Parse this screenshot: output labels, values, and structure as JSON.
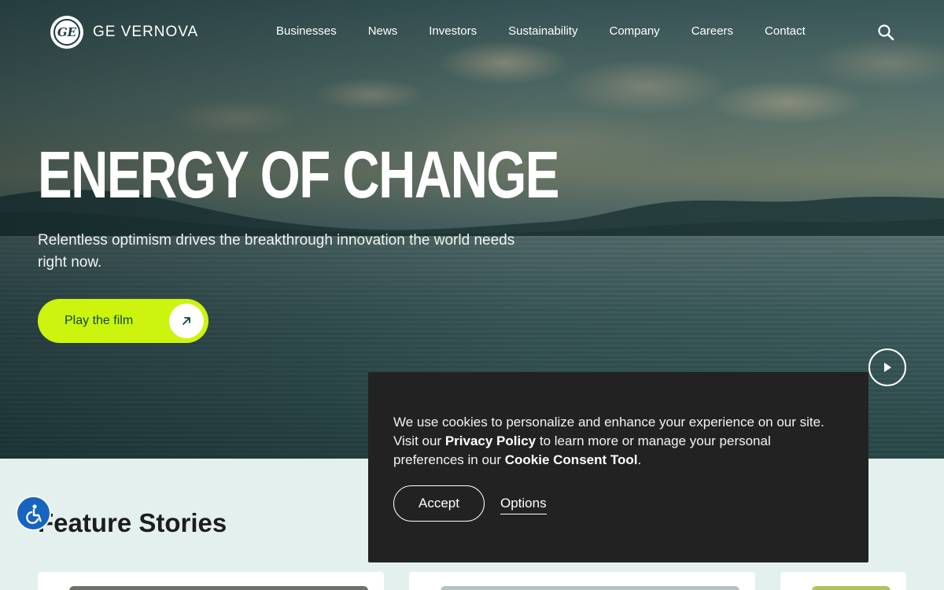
{
  "header": {
    "brand": "GE VERNOVA",
    "logo_monogram": "GE",
    "nav": [
      "Businesses",
      "News",
      "Investors",
      "Sustainability",
      "Company",
      "Careers",
      "Contact"
    ]
  },
  "hero": {
    "title": "ENERGY OF CHANGE",
    "subtitle": "Relentless optimism drives the breakthrough innovation the world needs right now.",
    "cta_label": "Play the film"
  },
  "feature": {
    "title": "Feature Stories"
  },
  "cookie_banner": {
    "text_1": "We use cookies to personalize and enhance your experience on our site. Visit our ",
    "privacy_link": "Privacy Policy",
    "text_2": " to learn more or manage your personal preferences in our ",
    "consent_link": "Cookie Consent Tool",
    "text_3": ".",
    "accept_label": "Accept",
    "options_label": "Options"
  },
  "icons": {
    "search": "search-icon",
    "arrow": "arrow-up-right-icon",
    "play": "play-icon",
    "accessibility": "accessibility-icon"
  },
  "colors": {
    "cta_background": "#ccf40e",
    "cta_text": "#0c4a3e",
    "section_background": "#e3f0ee",
    "cookie_background": "#222222",
    "accessibility_button": "#1764c0"
  }
}
